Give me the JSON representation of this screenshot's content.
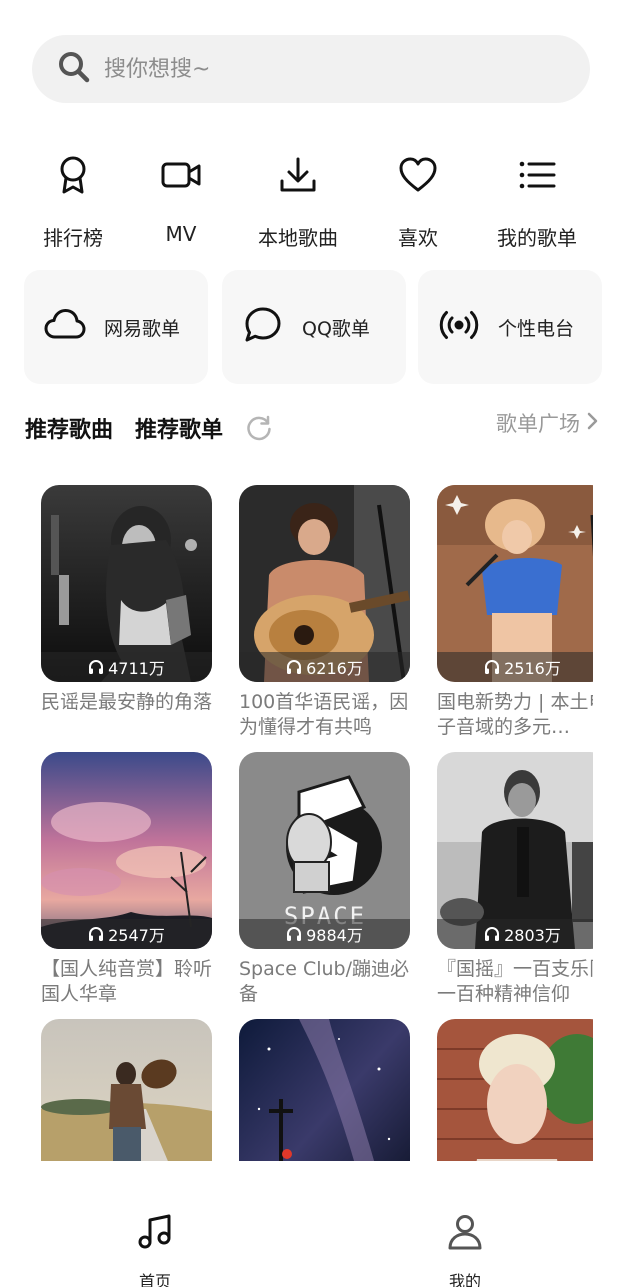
{
  "search": {
    "placeholder": "搜你想搜~"
  },
  "quick_actions": [
    {
      "label": "排行榜",
      "icon": "ribbon-badge-icon"
    },
    {
      "label": "MV",
      "icon": "video-camera-icon"
    },
    {
      "label": "本地歌曲",
      "icon": "download-icon"
    },
    {
      "label": "喜欢",
      "icon": "heart-icon"
    },
    {
      "label": "我的歌单",
      "icon": "list-icon"
    }
  ],
  "sources": [
    {
      "label": "网易歌单",
      "icon": "cloud-icon"
    },
    {
      "label": "QQ歌单",
      "icon": "chat-bubble-icon"
    },
    {
      "label": "个性电台",
      "icon": "radio-broadcast-icon"
    }
  ],
  "section": {
    "tab_songs": "推荐歌曲",
    "tab_playlists": "推荐歌单",
    "plaza_label": "歌单广场",
    "refresh_icon": "refresh-icon"
  },
  "playlists": [
    {
      "plays": "4711万",
      "title": "民谣是最安静的角落"
    },
    {
      "plays": "6216万",
      "title": "100首华语民谣，因为懂得才有共鸣"
    },
    {
      "plays": "2516万",
      "title": "国电新势力 | 本土电子音域的多元…"
    },
    {
      "plays": "2547万",
      "title": "【国人纯音赏】聆听国人华章"
    },
    {
      "plays": "9884万",
      "title": "Space Club/蹦迪必备"
    },
    {
      "plays": "2803万",
      "title": "『国摇』一百支乐队一百种精神信仰"
    },
    {
      "plays": "",
      "title": ""
    },
    {
      "plays": "",
      "title": ""
    },
    {
      "plays": "",
      "title": ""
    }
  ],
  "cover_text": {
    "space": "SPACE"
  },
  "bottom_nav": [
    {
      "label": "首页",
      "icon": "music-note-icon"
    },
    {
      "label": "我的",
      "icon": "person-icon"
    }
  ],
  "colors": {
    "accent_text": "#1f1f1f",
    "muted": "#9a9a9a",
    "surface": "#f1f1f1"
  }
}
